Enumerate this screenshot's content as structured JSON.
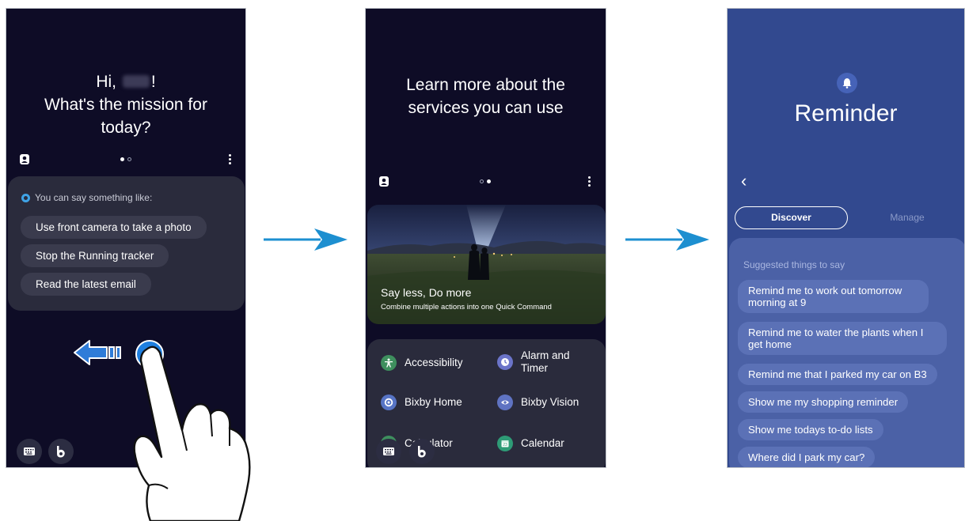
{
  "panel1": {
    "greeting_prefix": "Hi,",
    "greeting_suffix": "!",
    "greeting_line2": "What's the mission for",
    "greeting_line3": "today?",
    "hint": "You can say something like:",
    "suggestions": [
      "Use front camera to take a photo",
      "Stop the Running tracker",
      "Read the latest email"
    ]
  },
  "panel2": {
    "title_line1": "Learn more about the",
    "title_line2": "services you can use",
    "hero_title": "Say less, Do more",
    "hero_subtitle": "Combine multiple actions into one Quick Command",
    "services": {
      "accessibility": "Accessibility",
      "alarm": "Alarm and Timer",
      "bixby_home": "Bixby Home",
      "bixby_vision": "Bixby Vision",
      "calculator": "Calculator",
      "calendar": "Calendar"
    }
  },
  "panel3": {
    "title": "Reminder",
    "tab_discover": "Discover",
    "tab_manage": "Manage",
    "section_title": "Suggested things to say",
    "suggestions": [
      "Remind me to work out tomorrow morning at 9",
      "Remind me to water the plants when I get home",
      "Remind me that I parked my car on B3",
      "Show me my shopping reminder",
      "Show me todays to-do lists",
      "Where did I park my car?"
    ]
  },
  "colors": {
    "dark_bg": "#0e0c26",
    "card_bg": "#2a2b3c",
    "reminder_bg": "#32498f",
    "arrow": "#1d8fd0"
  }
}
